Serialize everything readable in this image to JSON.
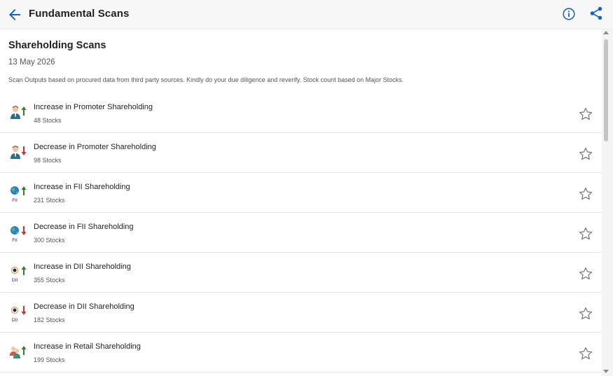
{
  "header": {
    "title": "Fundamental Scans",
    "back_icon": "arrow-left-icon",
    "info_icon": "info-circle-icon",
    "share_icon": "share-icon",
    "accent_color": "#1565c0"
  },
  "section": {
    "title": "Shareholding Scans",
    "date": "13 May 2026",
    "disclaimer": "Scan Outputs based on procured data from third party sources. Kindly do your due diligence and reverify. Stock count based on Major Stocks."
  },
  "scans": [
    {
      "name": "Increase in Promoter Shareholding",
      "count": "48 Stocks",
      "icon": "promoter-increase-icon",
      "direction": "up",
      "holder": "promoter"
    },
    {
      "name": "Decrease in Promoter Shareholding",
      "count": "98 Stocks",
      "icon": "promoter-decrease-icon",
      "direction": "down",
      "holder": "promoter"
    },
    {
      "name": "Increase in FII Shareholding",
      "count": "231 Stocks",
      "icon": "fii-increase-icon",
      "direction": "up",
      "holder": "fii",
      "badge": "FII"
    },
    {
      "name": "Decrease in FII Shareholding",
      "count": "300 Stocks",
      "icon": "fii-decrease-icon",
      "direction": "down",
      "holder": "fii",
      "badge": "FII"
    },
    {
      "name": "Increase in DII Shareholding",
      "count": "355 Stocks",
      "icon": "dii-increase-icon",
      "direction": "up",
      "holder": "dii",
      "badge": "DII"
    },
    {
      "name": "Decrease in DII Shareholding",
      "count": "182 Stocks",
      "icon": "dii-decrease-icon",
      "direction": "down",
      "holder": "dii",
      "badge": "DII"
    },
    {
      "name": "Increase in Retail Shareholding",
      "count": "199 Stocks",
      "icon": "retail-increase-icon",
      "direction": "up",
      "holder": "retail"
    }
  ],
  "colors": {
    "up": "#2e7d32",
    "down": "#d32f2f",
    "star": "#7a7a7a"
  }
}
